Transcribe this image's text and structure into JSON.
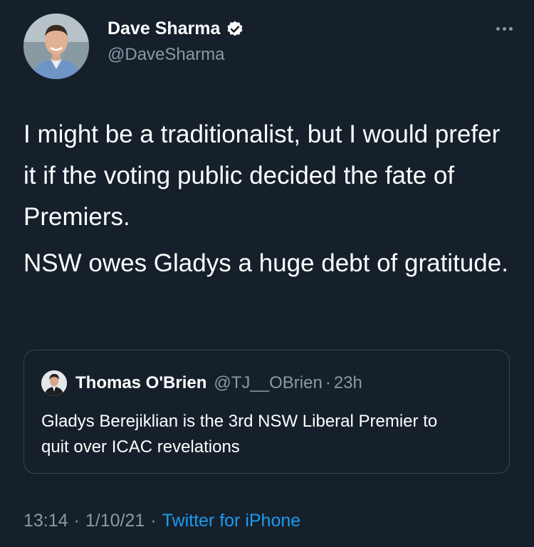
{
  "author": {
    "name": "Dave Sharma",
    "handle": "@DaveSharma",
    "avatar_icon": "avatar-photo-icon",
    "verified_icon": "verified-badge-icon"
  },
  "tweet": {
    "paragraphs": [
      "I might be a traditionalist, but I would prefer it if the voting public decided the fate of Premiers.",
      "NSW owes Gladys a huge debt of gratitude."
    ]
  },
  "quote": {
    "name": "Thomas O'Brien",
    "handle": "@TJ__OBrien",
    "separator": "·",
    "time": "23h",
    "text": "Gladys Berejiklian is the 3rd NSW Liberal Premier to quit over ICAC revelations"
  },
  "meta": {
    "time": "13:14",
    "separator": "·",
    "date": "1/10/21",
    "source": "Twitter for iPhone"
  },
  "colors": {
    "background": "#15202b",
    "muted": "#8b98a5",
    "accent": "#1d9bf0",
    "border": "#38444d"
  }
}
